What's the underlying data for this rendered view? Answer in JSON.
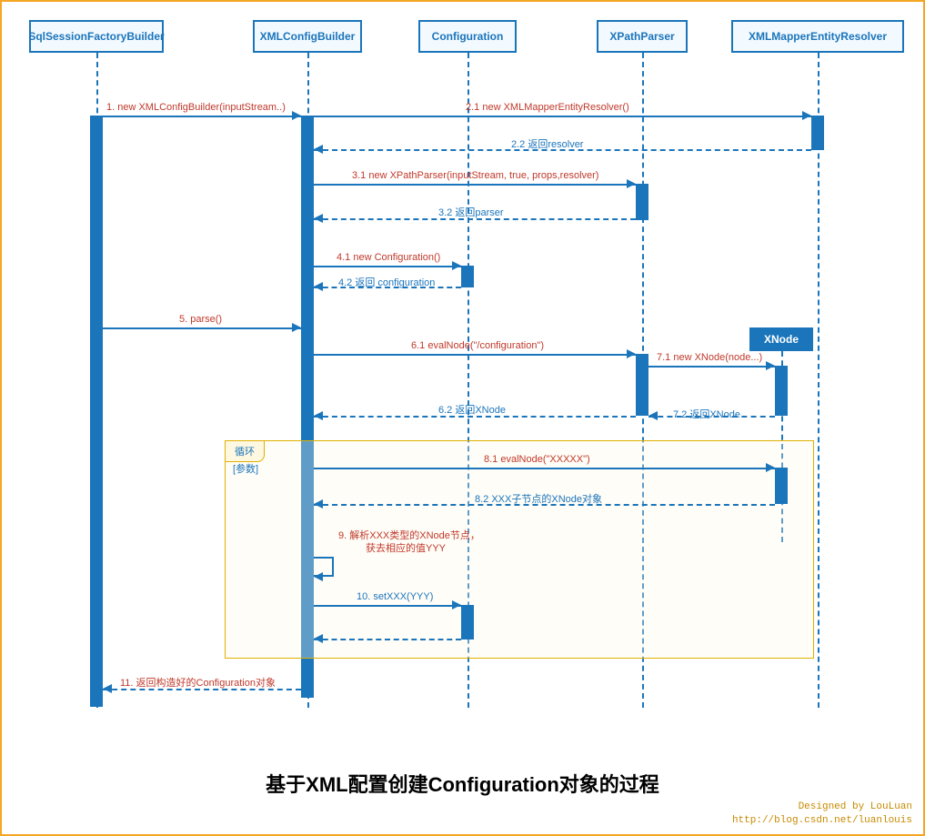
{
  "lifelines": {
    "p1": "SqlSessionFactoryBuilder",
    "p2": "XMLConfigBuilder",
    "p3": "Configuration",
    "p4": "XPathParser",
    "p5": "XMLMapperEntityResolver"
  },
  "created": {
    "xnode": "XNode"
  },
  "messages": {
    "m1": "1. new XMLConfigBuilder(inputStream..)",
    "m21": "2.1 new XMLMapperEntityResolver()",
    "m22": "2.2 返回resolver",
    "m31": "3.1 new XPathParser(inputStream, true, props,resolver)",
    "m32": "3.2  返回parser",
    "m41": "4.1 new Configuration()",
    "m42": "4.2 返回 configuration",
    "m5": "5. parse()",
    "m61": "6.1  evalNode(\"/configuration\")",
    "m62": "6.2  返回XNode",
    "m71": "7.1 new XNode(node...)",
    "m72": "7.2 返回XNode",
    "m81": "8.1 evalNode(\"XXXXX\")",
    "m82": "8.2 XXX子节点的XNode对象",
    "m9a": "9. 解析XXX类型的XNode节点，",
    "m9b": "获去相应的值YYY",
    "m10": "10. setXXX(YYY)",
    "m11": "11. 返回构造好的Configuration对象"
  },
  "loop": {
    "tag": "循环",
    "cond": "[参数]"
  },
  "title": "基于XML配置创建Configuration对象的过程",
  "credits": {
    "by": "Designed by LouLuan",
    "url": "http://blog.csdn.net/luanlouis"
  }
}
